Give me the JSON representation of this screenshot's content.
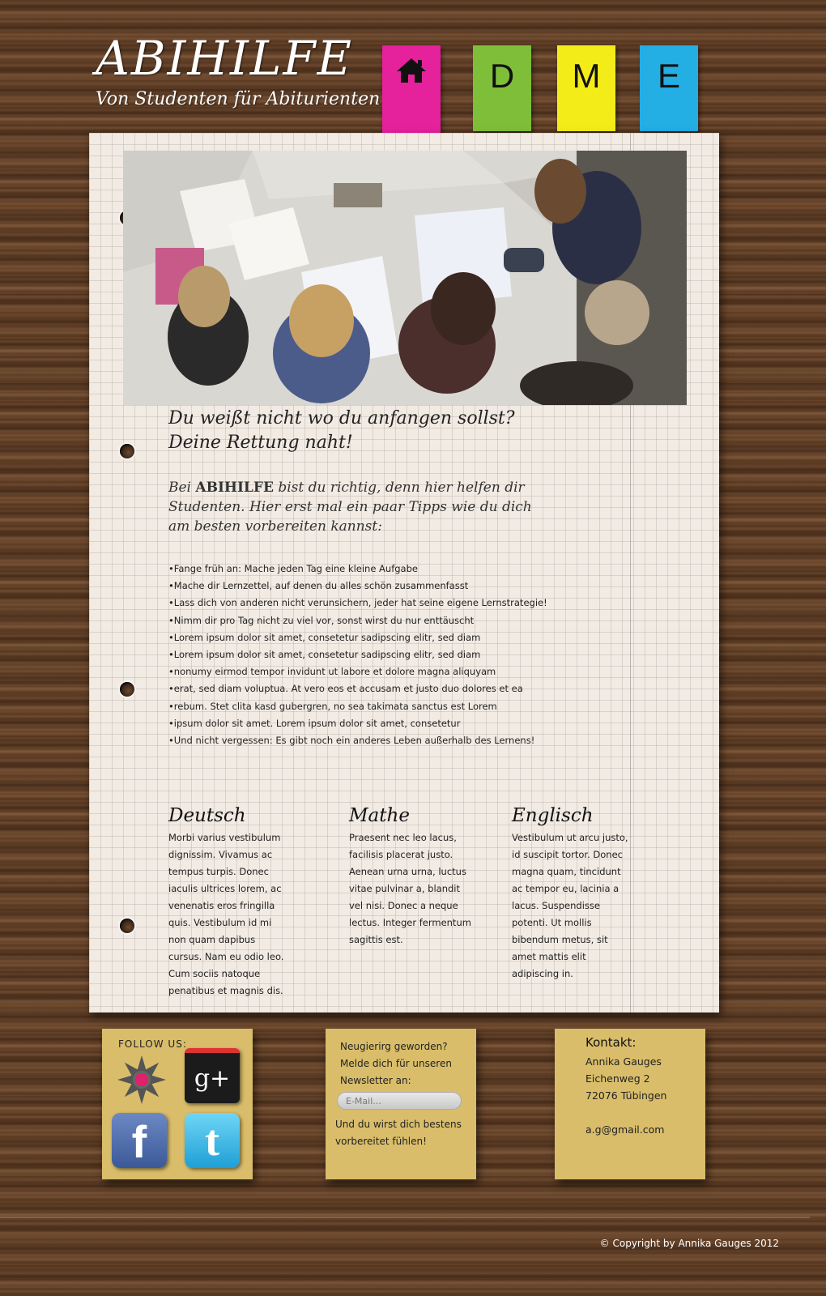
{
  "header": {
    "title": "ABIHILFE",
    "subtitle": "Von Studenten für Abiturienten"
  },
  "nav": {
    "tabs": [
      {
        "icon": "home-icon",
        "color": "#e6219c"
      },
      {
        "label": "D",
        "color": "#7fbe39"
      },
      {
        "label": "M",
        "color": "#f4ec18"
      },
      {
        "label": "E",
        "color": "#23aee4"
      }
    ]
  },
  "main": {
    "headline_line1": "Du weißt nicht wo du anfangen sollst?",
    "headline_line2": "Deine Rettung naht!",
    "intro_before": "Bei ",
    "intro_brand": "ABIHILFE",
    "intro_after": " bist du richtig, denn hier helfen dir Studenten. Hier erst mal ein paar Tipps wie du dich am besten vorbereiten kannst:",
    "tips": [
      "Fange früh an: Mache jeden Tag eine kleine Aufgabe",
      "Mache dir Lernzettel, auf denen du alles schön zusammenfasst",
      "Lass dich von anderen nicht verunsichern, jeder hat seine eigene Lernstrategie!",
      "Nimm dir pro Tag nicht zu viel vor, sonst wirst du nur enttäuscht",
      "Lorem ipsum dolor sit amet, consetetur sadipscing elitr, sed diam",
      "Lorem ipsum dolor sit amet, consetetur sadipscing elitr, sed diam",
      "nonumy eirmod tempor invidunt ut labore et dolore magna aliquyam",
      "erat, sed diam voluptua. At vero eos et accusam et justo duo dolores et ea",
      "rebum. Stet clita kasd gubergren, no sea takimata sanctus est Lorem",
      "ipsum dolor sit amet. Lorem ipsum dolor sit amet, consetetur",
      "Und nicht vergessen: Es gibt noch ein anderes Leben außerhalb des Lernens!"
    ],
    "columns": [
      {
        "title": "Deutsch",
        "text": "Morbi varius vestibulum dignissim. Vivamus ac tempus turpis. Donec iaculis ultrices lorem, ac venenatis eros fringilla quis. Vestibulum id mi non quam dapibus cursus. Nam eu odio leo. Cum sociis natoque penatibus et magnis dis."
      },
      {
        "title": "Mathe",
        "text": "Praesent nec leo lacus, facilisis placerat justo. Aenean urna urna, luctus vitae pulvinar a, blandit vel nisi. Donec a neque lectus. Integer fermentum sagittis est."
      },
      {
        "title": "Englisch",
        "text": "Vestibulum ut arcu justo, id suscipit tortor. Donec magna quam, tincidunt ac tempor eu, lacinia a lacus. Suspendisse potenti. Ut mollis bibendum metus, sit amet mattis elit adipiscing in."
      }
    ]
  },
  "follow": {
    "label": "FOLLOW US:",
    "icons": [
      "flower-icon",
      "google-plus-icon",
      "facebook-icon",
      "twitter-icon"
    ],
    "gplus_glyph": "g+",
    "facebook_glyph": "f",
    "twitter_glyph": "t"
  },
  "newsletter": {
    "text1": "Neugierirg geworden? Melde dich für unseren Newsletter an:",
    "email_placeholder": "E-Mail...",
    "text2": "Und du wirst dich bestens vorbereitet fühlen!"
  },
  "contact": {
    "title": "Kontakt:",
    "lines": [
      "Annika Gauges",
      "Eichenweg 2",
      "72076 Tübingen",
      "",
      "a.g@gmail.com"
    ]
  },
  "footer": {
    "copyright": "© Copyright by Annika Gauges 2012"
  }
}
